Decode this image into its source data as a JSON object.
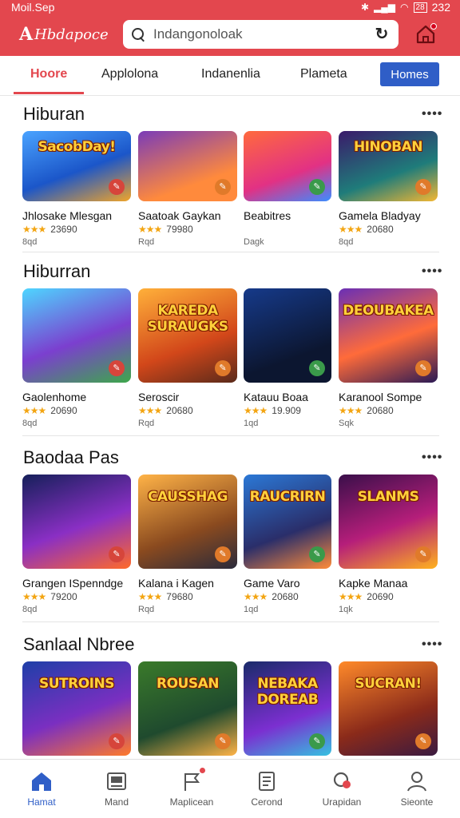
{
  "status": {
    "time": "Moil.Sep",
    "right": "≋ ᵂ⁄ ≋ ",
    "battery": "28",
    "clock": "232"
  },
  "app": {
    "logo_mark": "A",
    "logo_text": "Hbdapoce",
    "brand_color": "#e3474e",
    "accent_color": "#2f5ec7"
  },
  "search": {
    "value": "Indangonoloak",
    "placeholder": "Indangonoloak"
  },
  "tabs": [
    {
      "label": "Hoore"
    },
    {
      "label": "Applolona"
    },
    {
      "label": "Indanenlia"
    },
    {
      "label": "Plameta"
    }
  ],
  "tab_button": "Homes",
  "sections": [
    {
      "title": "Hiburan",
      "more": "••••",
      "games": [
        {
          "art_text": "SacobDay!",
          "name": "Jhlosake Mlesgan",
          "rating": "23690",
          "meta": "8qd"
        },
        {
          "art_text": "",
          "name": "Saatoak Gaykan",
          "rating": "79980",
          "meta": "Rqd"
        },
        {
          "art_text": "",
          "name": "Beabitres",
          "rating": "",
          "meta": "Dagk"
        },
        {
          "art_text": "HINOBAN",
          "name": "Gamela Bladyay",
          "rating": "20680",
          "meta": "8qd"
        }
      ]
    },
    {
      "title": "Hiburran",
      "more": "••••",
      "games": [
        {
          "art_text": "",
          "name": "Gaolenhome",
          "rating": "20690",
          "meta": "8qd"
        },
        {
          "art_text": "KAREDA SURAUGKS",
          "name": "Seroscir",
          "rating": "20680",
          "meta": "Rqd"
        },
        {
          "art_text": "",
          "name": "Katauu Boaa",
          "rating": "19.909",
          "meta": "1qd"
        },
        {
          "art_text": "DEOUBAKEA",
          "name": "Karanool Sompe",
          "rating": "20680",
          "meta": "Sqk"
        }
      ]
    },
    {
      "title": "Baodaa Pas",
      "more": "••••",
      "games": [
        {
          "art_text": "",
          "name": "Grangen ISpenndge",
          "rating": "79200",
          "meta": "8qd"
        },
        {
          "art_text": "CAUSSHAG",
          "name": "Kalana i Kagen",
          "rating": "79680",
          "meta": "Rqd"
        },
        {
          "art_text": "RAUCRIRN",
          "name": "Game Varo",
          "rating": "20680",
          "meta": "1qd"
        },
        {
          "art_text": "SLANMS",
          "name": "Kapke Manaa",
          "rating": "20690",
          "meta": "1qk"
        }
      ]
    },
    {
      "title": "Sanlaal Nbree",
      "more": "••••",
      "games": [
        {
          "art_text": "SUTROINS",
          "name": "",
          "rating": "",
          "meta": ""
        },
        {
          "art_text": "ROUSAN",
          "name": "",
          "rating": "",
          "meta": ""
        },
        {
          "art_text": "NEBAKA DOREAB",
          "name": "",
          "rating": "",
          "meta": ""
        },
        {
          "art_text": "SUCRAN!",
          "name": "",
          "rating": "",
          "meta": ""
        }
      ]
    }
  ],
  "nav": [
    {
      "label": "Hamat",
      "icon": "home-icon"
    },
    {
      "label": "Mand",
      "icon": "gallery-icon"
    },
    {
      "label": "Maplicean",
      "icon": "flag-icon"
    },
    {
      "label": "Cerond",
      "icon": "document-icon"
    },
    {
      "label": "Urapidan",
      "icon": "location-icon"
    },
    {
      "label": "Sieonte",
      "icon": "profile-icon"
    }
  ]
}
